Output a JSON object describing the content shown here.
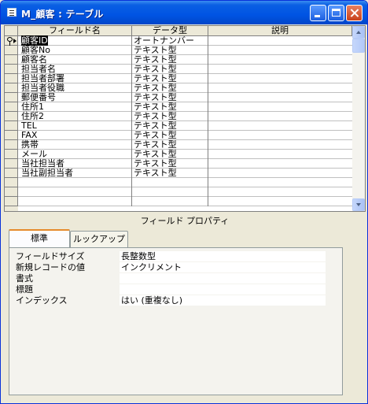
{
  "window": {
    "title": "M_顧客 : テーブル"
  },
  "grid": {
    "columns": [
      "フィールド名",
      "データ型",
      "説明"
    ],
    "rows": [
      {
        "name": "顧客ID",
        "type": "オートナンバー"
      },
      {
        "name": "顧客No",
        "type": "テキスト型"
      },
      {
        "name": "顧客名",
        "type": "テキスト型"
      },
      {
        "name": "担当者名",
        "type": "テキスト型"
      },
      {
        "name": "担当者部署",
        "type": "テキスト型"
      },
      {
        "name": "担当者役職",
        "type": "テキスト型"
      },
      {
        "name": "郵便番号",
        "type": "テキスト型"
      },
      {
        "name": "住所1",
        "type": "テキスト型"
      },
      {
        "name": "住所2",
        "type": "テキスト型"
      },
      {
        "name": "TEL",
        "type": "テキスト型"
      },
      {
        "name": "FAX",
        "type": "テキスト型"
      },
      {
        "name": "携帯",
        "type": "テキスト型"
      },
      {
        "name": "メール",
        "type": "テキスト型"
      },
      {
        "name": "当社担当者",
        "type": "テキスト型"
      },
      {
        "name": "当社副担当者",
        "type": "テキスト型"
      },
      {
        "name": "",
        "type": ""
      },
      {
        "name": "",
        "type": ""
      },
      {
        "name": "",
        "type": ""
      }
    ]
  },
  "properties": {
    "title": "フィールド プロパティ",
    "tabs": [
      "標準",
      "ルックアップ"
    ],
    "fields": [
      {
        "label": "フィールドサイズ",
        "value": "長整数型"
      },
      {
        "label": "新規レコードの値",
        "value": "インクリメント"
      },
      {
        "label": "書式",
        "value": ""
      },
      {
        "label": "標題",
        "value": ""
      },
      {
        "label": "インデックス",
        "value": "はい (重複なし)"
      }
    ]
  }
}
